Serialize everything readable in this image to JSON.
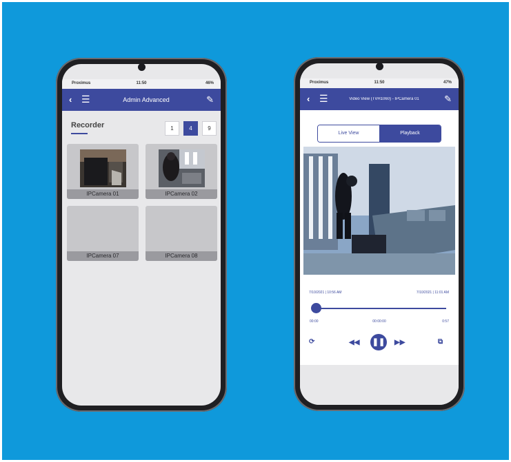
{
  "left_phone": {
    "status": {
      "carrier": "Proximus",
      "time": "11:50",
      "battery": "46%"
    },
    "appbar": {
      "title": "Admin Advanced"
    },
    "section_title": "Recorder",
    "grid_options": [
      "1",
      "4",
      "9"
    ],
    "selected_grid": "4",
    "cameras": [
      {
        "name": "IPCamera 01"
      },
      {
        "name": "IPCamera 02"
      },
      {
        "name": "IPCamera 07"
      },
      {
        "name": "IPCamera 08"
      }
    ]
  },
  "right_phone": {
    "status": {
      "carrier": "Proximus",
      "time": "11:50",
      "battery": "47%"
    },
    "appbar": {
      "title": "Video View (TVH1060) - IPCamera 01"
    },
    "tabs": {
      "live": "Live View",
      "playback": "Playback"
    },
    "timeline": {
      "start": "7/10/2021 | 10:56 AM",
      "end": "7/10/2021 | 11:01 AM"
    },
    "playback_position": 0,
    "times": {
      "start": "00:00",
      "current": "00:00:00",
      "end": "0:57"
    }
  },
  "colors": {
    "background": "#0f99db",
    "accent": "#3d4a9e"
  }
}
